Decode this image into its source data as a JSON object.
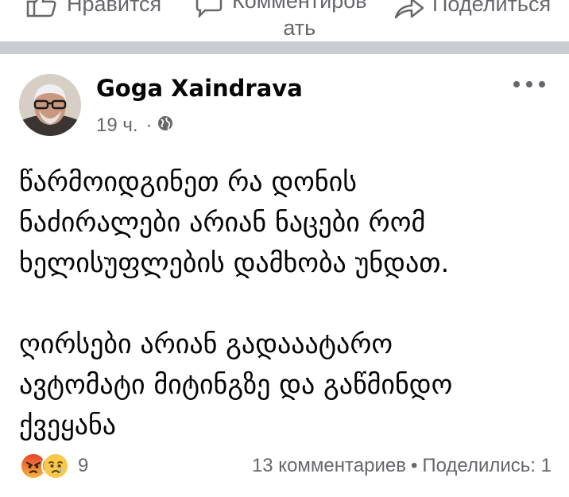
{
  "actions": {
    "like_label": "Нравится",
    "comment_label_line1": "Комментиров",
    "comment_label_line2": "ать",
    "share_label": "Поделиться"
  },
  "post": {
    "author": "Goga Xaindrava",
    "time": "19 ч.",
    "meta_separator": "·",
    "audience_icon": "globe-icon",
    "more_icon": "more-options-icon",
    "paragraph1": [
      "წარმოიდგინეთ რა დონის",
      "ნაძირალები არიან ნაცები რომ",
      "ხელისუფლების დამხობა უნდათ."
    ],
    "paragraph2": [
      "ღირსები არიან გადააატარო",
      "ავტომატი მიტინგზე და გაწმინდო",
      "ქვეყანა"
    ],
    "reactions": {
      "icons": [
        "angry-reaction-icon",
        "sad-reaction-icon"
      ],
      "count": "9"
    },
    "comments_text": "13 комментариев",
    "stats_separator": "•",
    "shares_text": "Поделились: 1"
  },
  "colors": {
    "secondary_text": "#65676b",
    "separator": "#c9ccd1",
    "angry": "#f0663c",
    "sad": "#f7c84a"
  }
}
